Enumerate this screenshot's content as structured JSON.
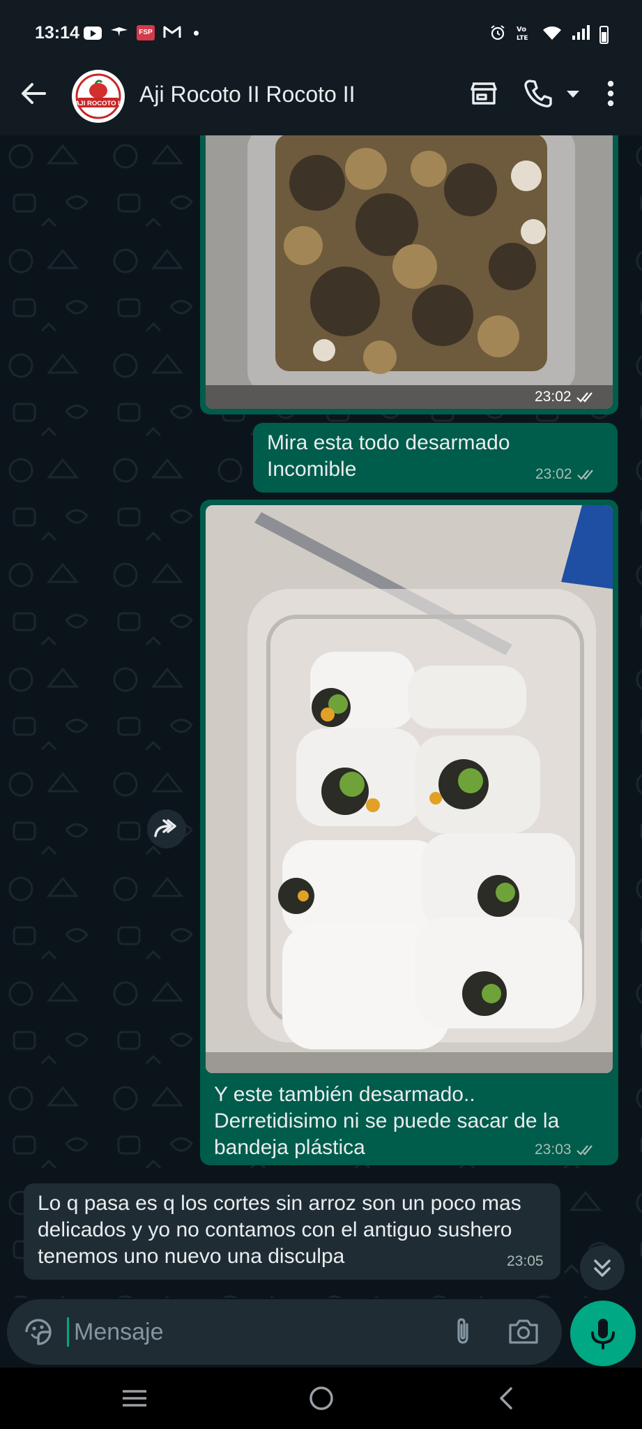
{
  "status_bar": {
    "time": "13:14",
    "left_icons": [
      "youtube-icon",
      "vpn-bird-icon",
      "fsp-app-icon",
      "gmail-icon",
      "notification-dot"
    ],
    "right_icons": [
      "alarm-icon",
      "volte-icon",
      "wifi-icon",
      "signal-icon",
      "battery-icon"
    ]
  },
  "header": {
    "contact_name": "Aji Rocoto II Rocoto II",
    "avatar_label": "AJI ROCOTO II",
    "avatar_arc_text": "RESTAURANT PERUANO",
    "icons": [
      "back-arrow-icon",
      "store-icon",
      "phone-icon",
      "dropdown-caret-icon",
      "more-vertical-icon"
    ]
  },
  "messages": [
    {
      "type": "image",
      "direction": "outgoing",
      "time": "23:02",
      "status": "read"
    },
    {
      "type": "text",
      "direction": "outgoing",
      "lines": [
        "Mira esta todo desarmado",
        "Incomible"
      ],
      "time": "23:02",
      "status": "read"
    },
    {
      "type": "image",
      "direction": "outgoing",
      "caption_lines": [
        "Y este también desarmado..",
        "Derretidisimo ni se puede sacar de la",
        "bandeja plástica"
      ],
      "time": "23:03",
      "status": "read"
    },
    {
      "type": "text",
      "direction": "incoming",
      "lines": [
        "Lo q pasa es q los cortes sin arroz son un poco mas",
        "delicados y yo no contamos con el antiguo sushero",
        "tenemos uno nuevo una disculpa"
      ],
      "time": "23:05"
    }
  ],
  "input": {
    "placeholder": "Mensaje",
    "icons": [
      "emoji-sticker-icon",
      "paperclip-icon",
      "camera-icon",
      "microphone-icon"
    ]
  },
  "colors": {
    "background": "#0b141a",
    "bar": "#121b22",
    "outgoing_bubble": "#005c4b",
    "incoming_bubble": "#1f2c34",
    "accent": "#00a884",
    "meta_text": "#a8bdb6"
  },
  "nav_bar": {
    "icons": [
      "recents-icon",
      "home-icon",
      "back-icon"
    ]
  }
}
